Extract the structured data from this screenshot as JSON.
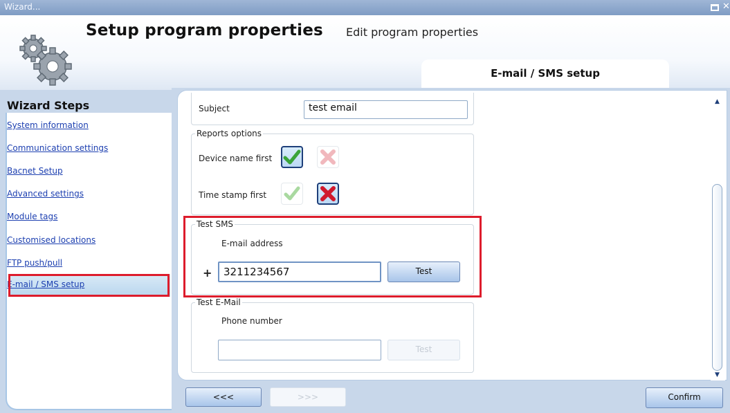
{
  "window": {
    "title": "Wizard..."
  },
  "header": {
    "title": "Setup program properties",
    "subtitle": "Edit program properties",
    "active_tab": "E-mail / SMS setup"
  },
  "sidebar": {
    "title": "Wizard Steps",
    "items": [
      {
        "label": "System information"
      },
      {
        "label": "Communication settings"
      },
      {
        "label": "Bacnet Setup"
      },
      {
        "label": "Advanced settings"
      },
      {
        "label": "Module tags"
      },
      {
        "label": "Customised locations"
      },
      {
        "label": "FTP push/pull"
      },
      {
        "label": "E-mail / SMS setup"
      }
    ],
    "selected": "E-mail / SMS setup"
  },
  "form": {
    "subject": {
      "label": "Subject",
      "value": "test email"
    },
    "reports_options": {
      "legend": "Reports options",
      "device_name_first": {
        "label": "Device name first",
        "value": "yes"
      },
      "time_stamp_first": {
        "label": "Time stamp first",
        "value": "no"
      }
    },
    "test_sms": {
      "legend": "Test SMS",
      "field_label": "E-mail address",
      "prefix": "+",
      "value": "3211234567",
      "button": "Test"
    },
    "test_email": {
      "legend": "Test E-Mail",
      "field_label": "Phone number",
      "value": "",
      "button": "Test"
    }
  },
  "footer": {
    "back": "<<<",
    "next": ">>>",
    "confirm": "Confirm"
  },
  "colors": {
    "highlight": "#dd1c2c",
    "link": "#1c3fb0",
    "check_green": "#3aa43a",
    "cross_red": "#d0192c"
  }
}
